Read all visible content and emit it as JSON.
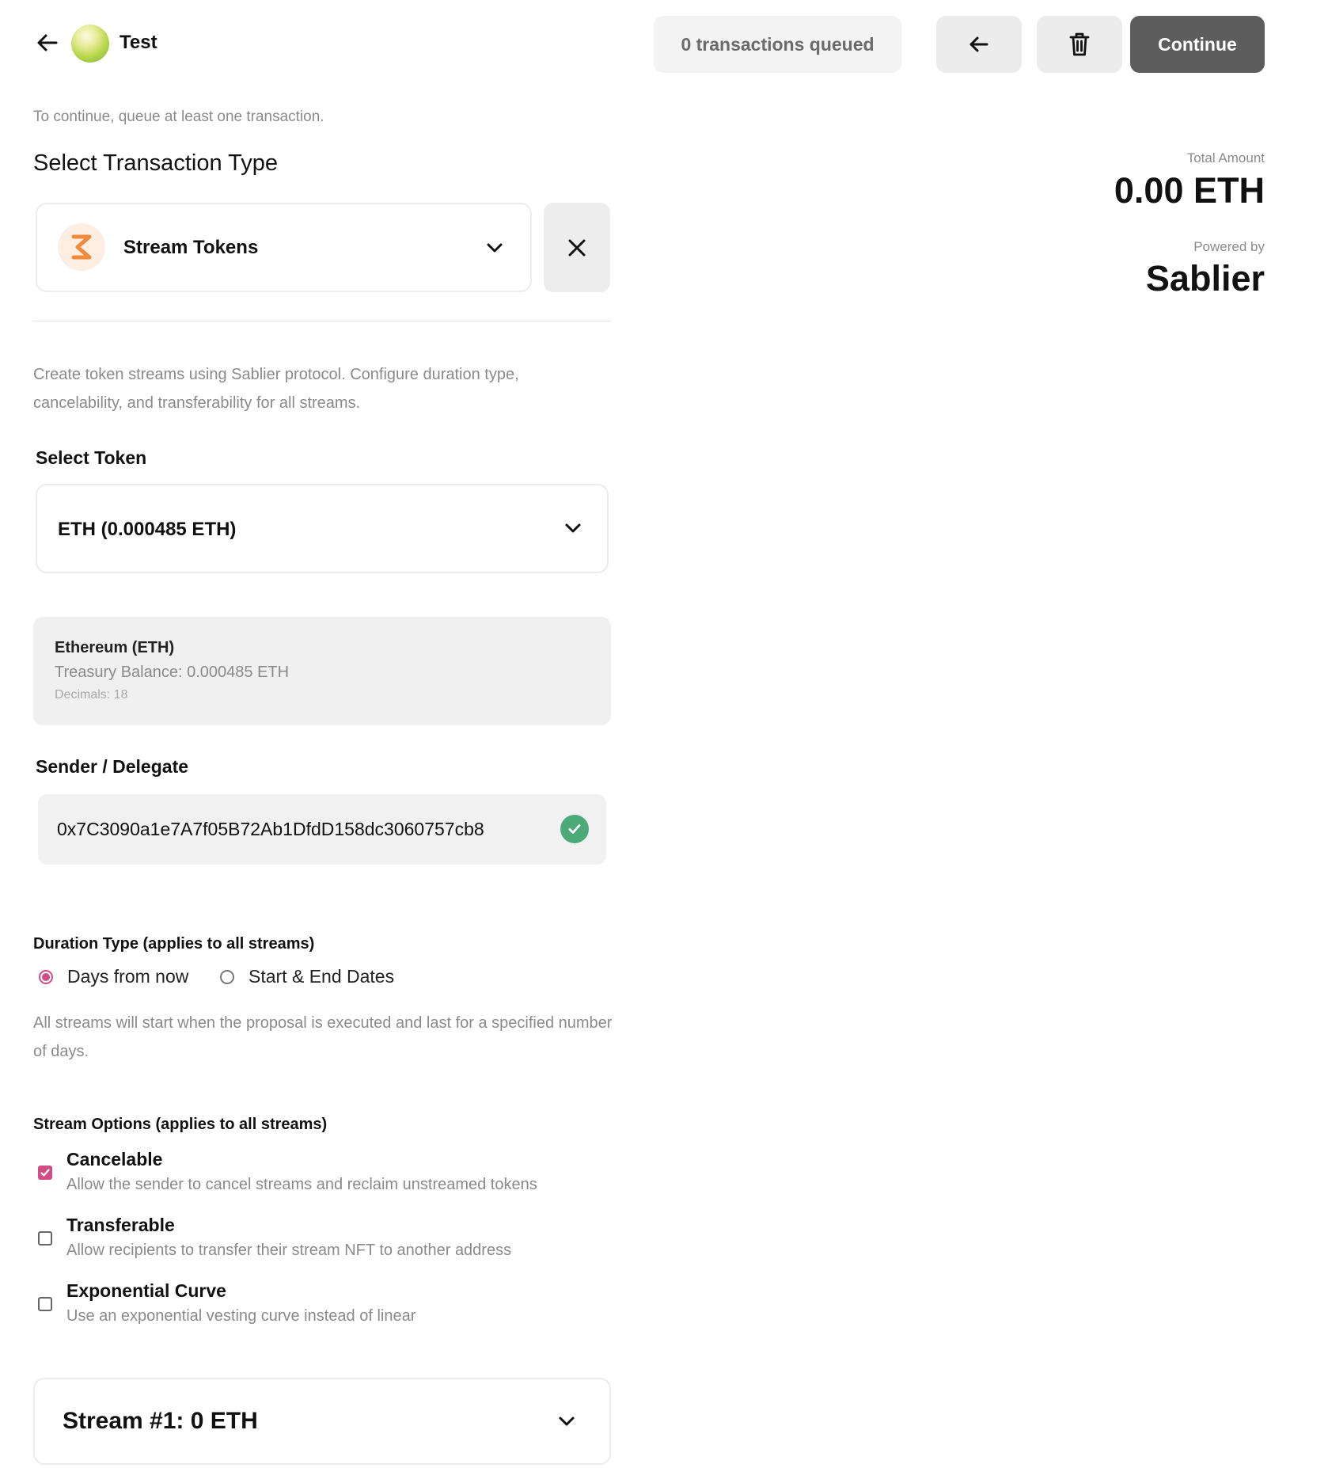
{
  "header": {
    "dao_name": "Test",
    "queue_status": "0 transactions queued",
    "continue_label": "Continue"
  },
  "hint": "To continue, queue at least one transaction.",
  "transaction_type": {
    "section_title": "Select Transaction Type",
    "selected": "Stream Tokens",
    "logo_icon": "sablier-logo-icon",
    "description": "Create token streams using Sablier protocol. Configure duration type, cancelability, and transferability for all streams."
  },
  "token": {
    "label": "Select Token",
    "selected": "ETH (0.000485 ETH)",
    "info": {
      "name": "Ethereum (ETH)",
      "balance": "Treasury Balance: 0.000485 ETH",
      "decimals": "Decimals: 18"
    }
  },
  "sender": {
    "label": "Sender / Delegate",
    "address": "0x7C3090a1e7A7f05B72Ab1DfdD158dc3060757cb8",
    "valid": true
  },
  "duration": {
    "label": "Duration Type (applies to all streams)",
    "options": [
      {
        "label": "Days from now",
        "selected": true
      },
      {
        "label": "Start & End Dates",
        "selected": false
      }
    ],
    "description": "All streams will start when the proposal is executed and last for a specified number of days."
  },
  "stream_options": {
    "label": "Stream Options (applies to all streams)",
    "items": [
      {
        "title": "Cancelable",
        "description": "Allow the sender to cancel streams and reclaim unstreamed tokens",
        "checked": true
      },
      {
        "title": "Transferable",
        "description": "Allow recipients to transfer their stream NFT to another address",
        "checked": false
      },
      {
        "title": "Exponential Curve",
        "description": "Use an exponential vesting curve instead of linear",
        "checked": false
      }
    ]
  },
  "stream_card": {
    "title": "Stream #1: 0 ETH"
  },
  "summary": {
    "total_label": "Total Amount",
    "total_value": "0.00 ETH",
    "powered_label": "Powered by",
    "powered_value": "Sablier"
  },
  "colors": {
    "accent": "#d14d87",
    "success": "#4caa78",
    "continue_bg": "#5d5d5d",
    "sablier_orange": "#f08a3c"
  }
}
